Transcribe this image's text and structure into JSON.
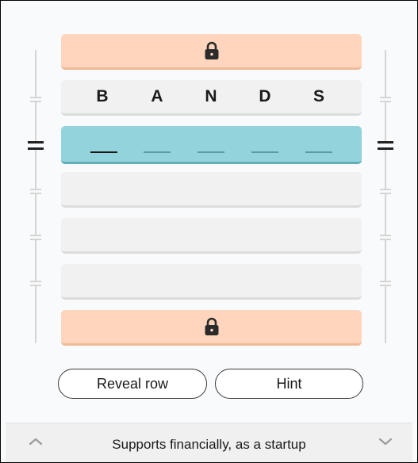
{
  "board": {
    "guess_row": {
      "letters": [
        "B",
        "A",
        "N",
        "D",
        "S"
      ]
    },
    "active_row": {
      "blank_count": 5,
      "cursor_index": 0
    }
  },
  "icons": {
    "top_lock": "lock-icon",
    "bottom_lock": "lock-icon",
    "up": "chevron-up-icon",
    "down": "chevron-down-icon"
  },
  "buttons": {
    "reveal_row": "Reveal row",
    "hint": "Hint"
  },
  "clue": {
    "text": "Supports financially, as a startup"
  },
  "colors": {
    "locked_row": "#ffd6bd",
    "active_row": "#92d3dc",
    "empty_row": "#f1f1f1"
  }
}
